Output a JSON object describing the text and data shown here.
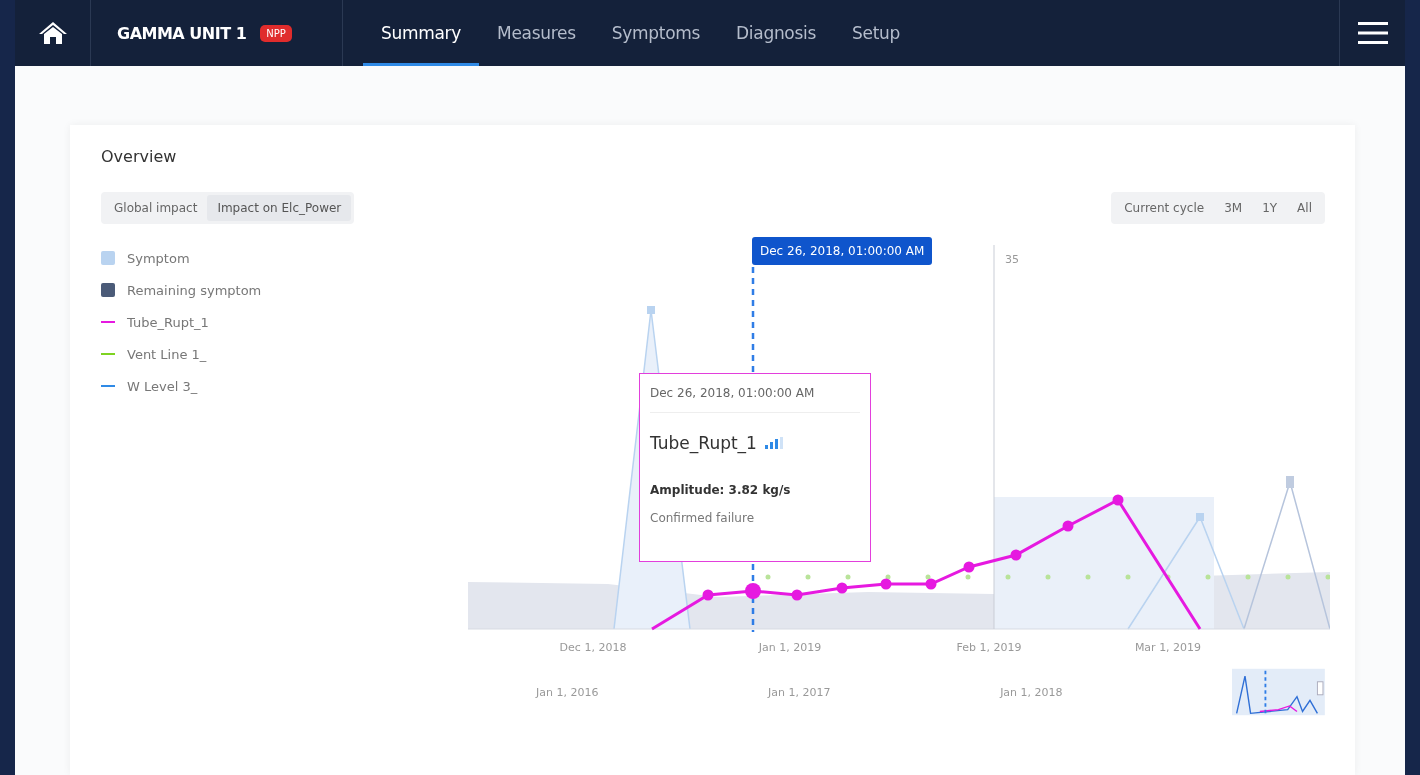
{
  "header": {
    "unit": "GAMMA UNIT 1",
    "badge": "NPP"
  },
  "tabs": [
    {
      "label": "Summary",
      "selected": true
    },
    {
      "label": "Measures",
      "selected": false
    },
    {
      "label": "Symptoms",
      "selected": false
    },
    {
      "label": "Diagnosis",
      "selected": false
    },
    {
      "label": "Setup",
      "selected": false
    }
  ],
  "overview": {
    "title": "Overview",
    "impact_toggle": [
      {
        "label": "Global impact",
        "selected": false
      },
      {
        "label": "Impact on Elc_Power",
        "selected": true
      }
    ],
    "range_toggle": [
      {
        "label": "Current cycle",
        "selected": false
      },
      {
        "label": "3M",
        "selected": false
      },
      {
        "label": "1Y",
        "selected": false
      },
      {
        "label": "All",
        "selected": false
      }
    ],
    "legend": [
      {
        "label": "Symptom",
        "kind": "square",
        "color": "#b9d3f0"
      },
      {
        "label": "Remaining symptom",
        "kind": "square",
        "color": "#4b5b78"
      },
      {
        "label": "Tube_Rupt_1",
        "kind": "line",
        "color": "#e619e0"
      },
      {
        "label": "Vent Line 1_",
        "kind": "line",
        "color": "#7ed321"
      },
      {
        "label": "W Level 3_",
        "kind": "line",
        "color": "#2f8ae6"
      }
    ],
    "chart": {
      "y_tick": "35",
      "x_labels": [
        "Dec 1, 2018",
        "Jan 1, 2019",
        "Feb 1, 2019",
        "Mar 1, 2019"
      ],
      "marker_time": "Dec 26, 2018, 01:00:00 AM",
      "tooltip": {
        "time": "Dec 26, 2018, 01:00:00 AM",
        "series": "Tube_Rupt_1",
        "amplitude": "Amplitude: 3.82 kg/s",
        "status": "Confirmed failure"
      }
    },
    "navigator": {
      "labels": [
        "Jan 1, 2016",
        "Jan 1, 2017",
        "Jan 1, 2018"
      ]
    }
  }
}
